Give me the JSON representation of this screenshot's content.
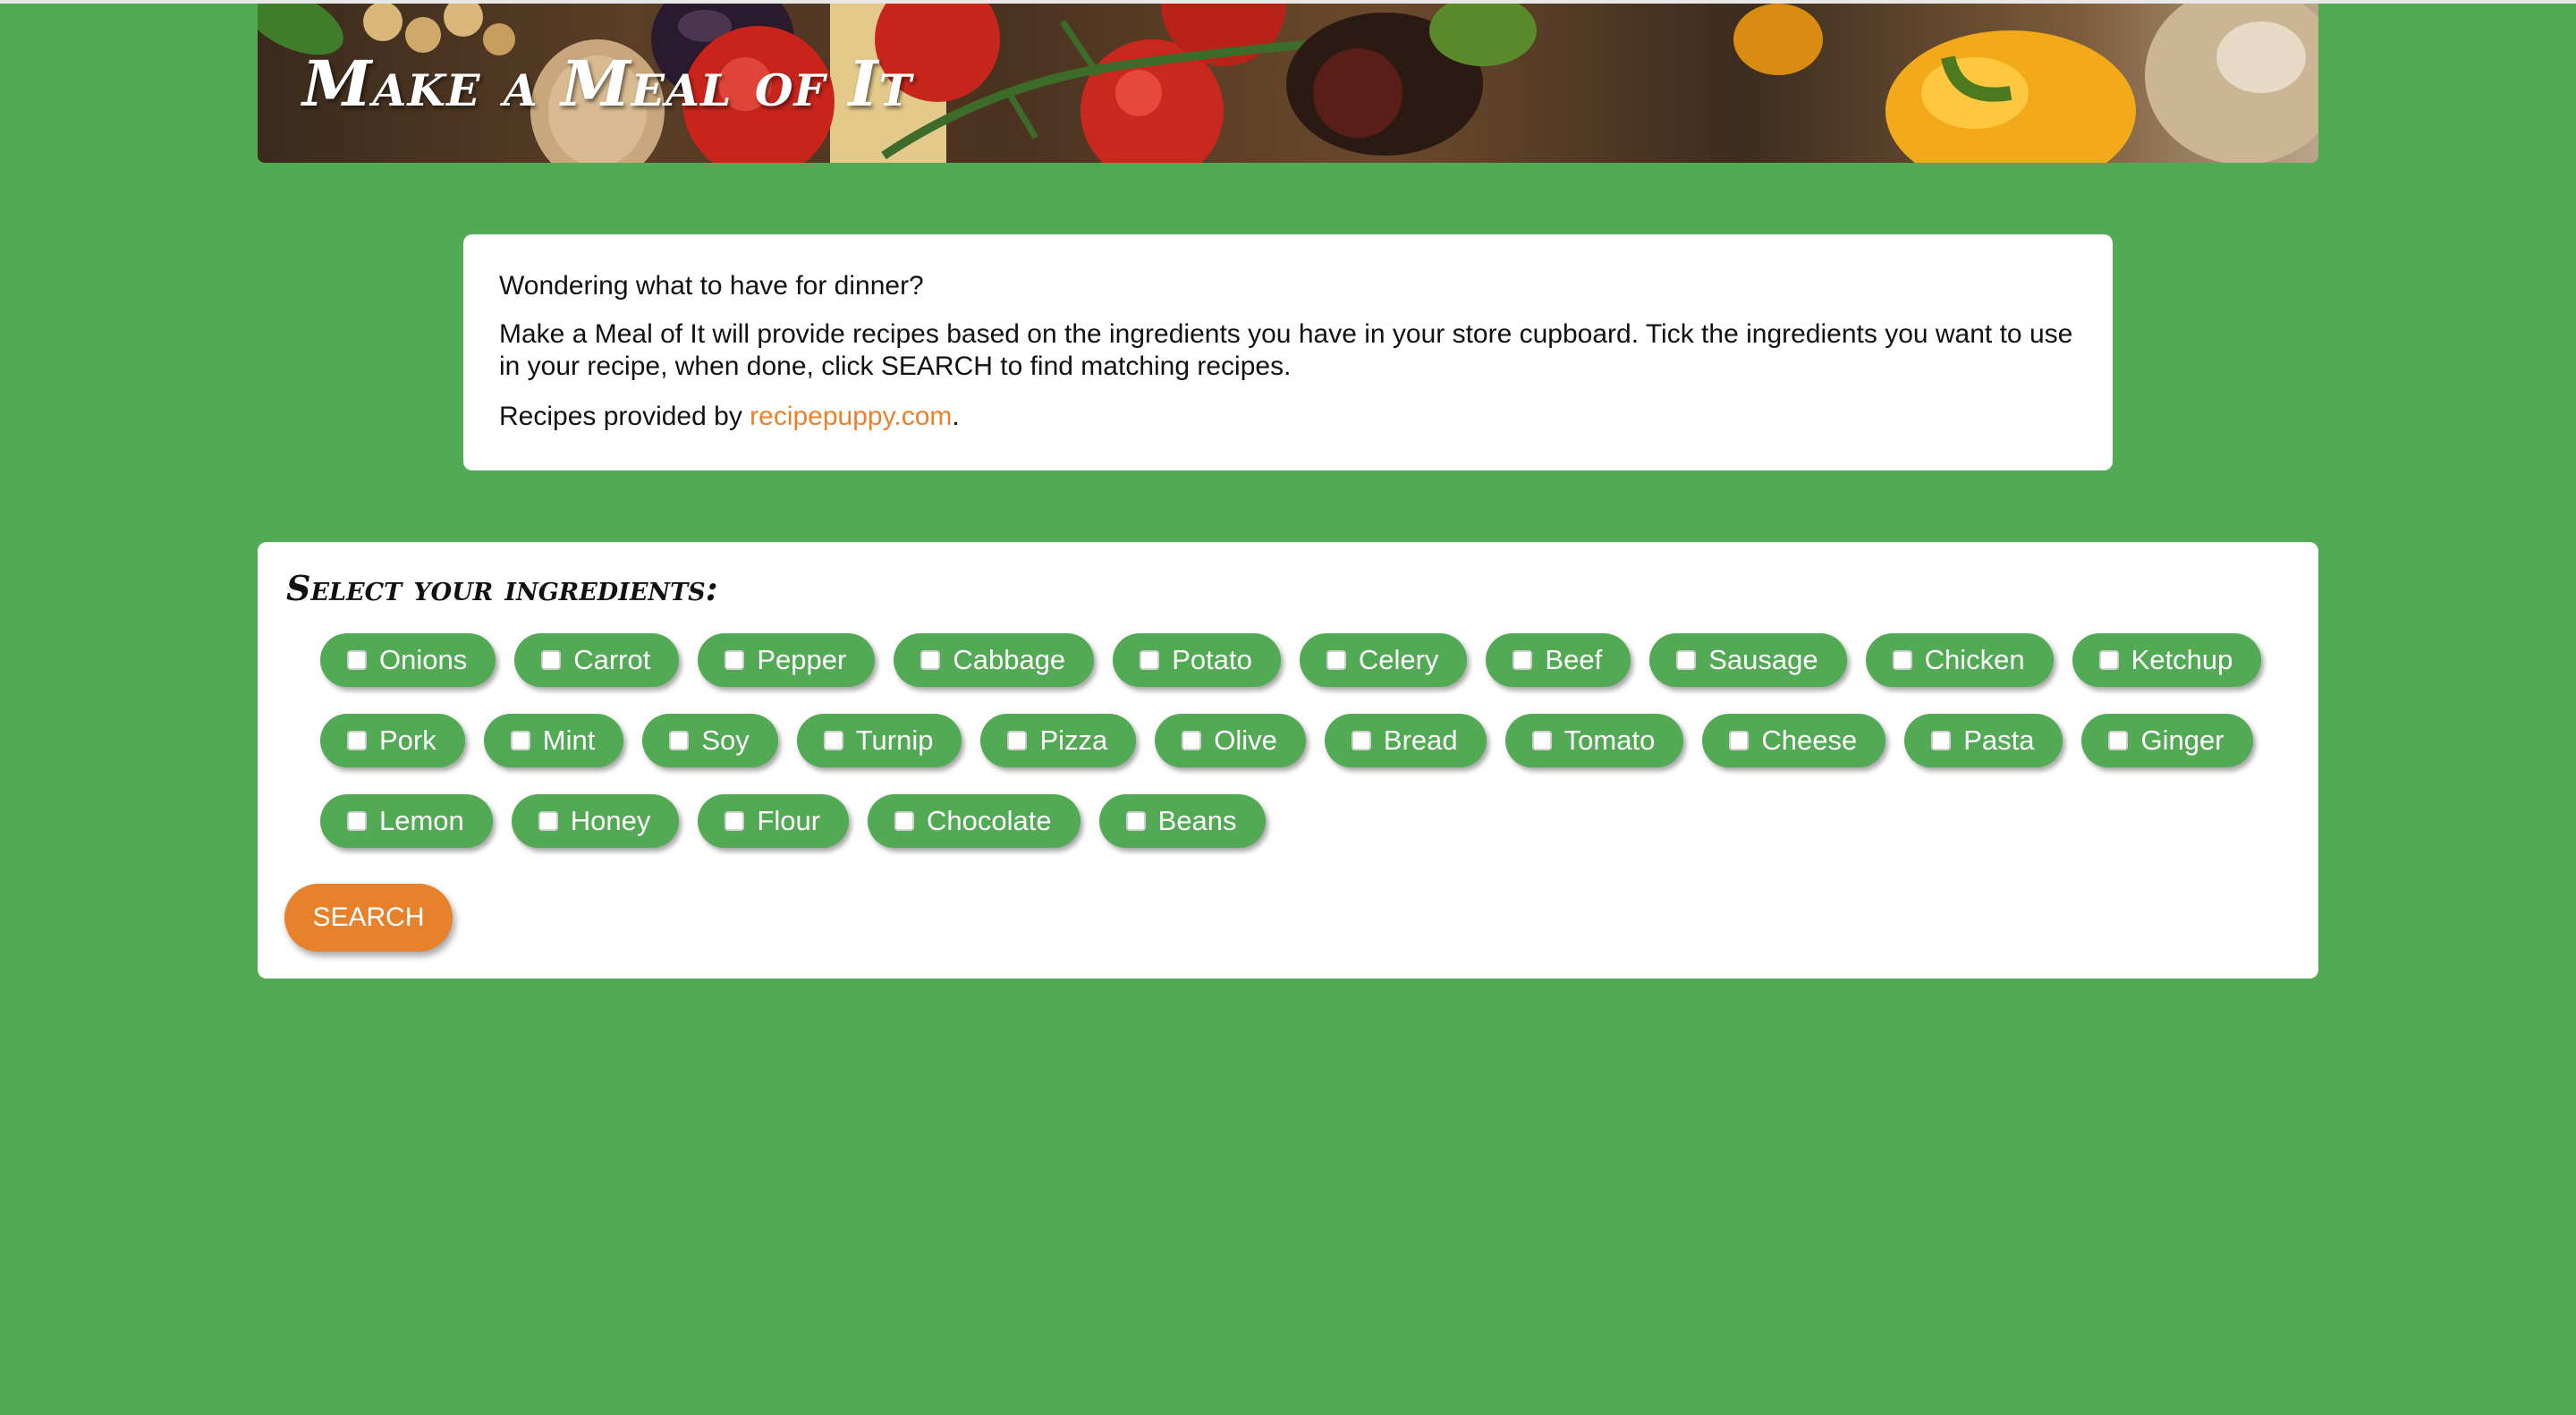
{
  "header": {
    "title": "Make a Meal of It"
  },
  "intro": {
    "line1": "Wondering what to have for dinner?",
    "line2": "Make a Meal of It will provide recipes based on the ingredients you have in your store cupboard. Tick the ingredients you want to use in your recipe, when done, click SEARCH to find matching recipes.",
    "line3_prefix": "Recipes provided by ",
    "link_text": "recipepuppy.com",
    "line3_suffix": "."
  },
  "ingredients": {
    "heading": "Select your ingredients:",
    "rows": [
      [
        "Onions",
        "Carrot",
        "Pepper",
        "Cabbage",
        "Potato",
        "Celery",
        "Beef",
        "Sausage",
        "Chicken",
        "Ketchup"
      ],
      [
        "Pork",
        "Mint",
        "Soy",
        "Turnip",
        "Pizza",
        "Olive",
        "Bread",
        "Tomato",
        "Cheese",
        "Pasta",
        "Ginger"
      ],
      [
        "Lemon",
        "Honey",
        "Flour",
        "Chocolate",
        "Beans"
      ]
    ],
    "search_label": "SEARCH"
  },
  "colors": {
    "background": "#53aa55",
    "chip": "#53aa55",
    "accent": "#e8812c",
    "panel": "#ffffff"
  }
}
